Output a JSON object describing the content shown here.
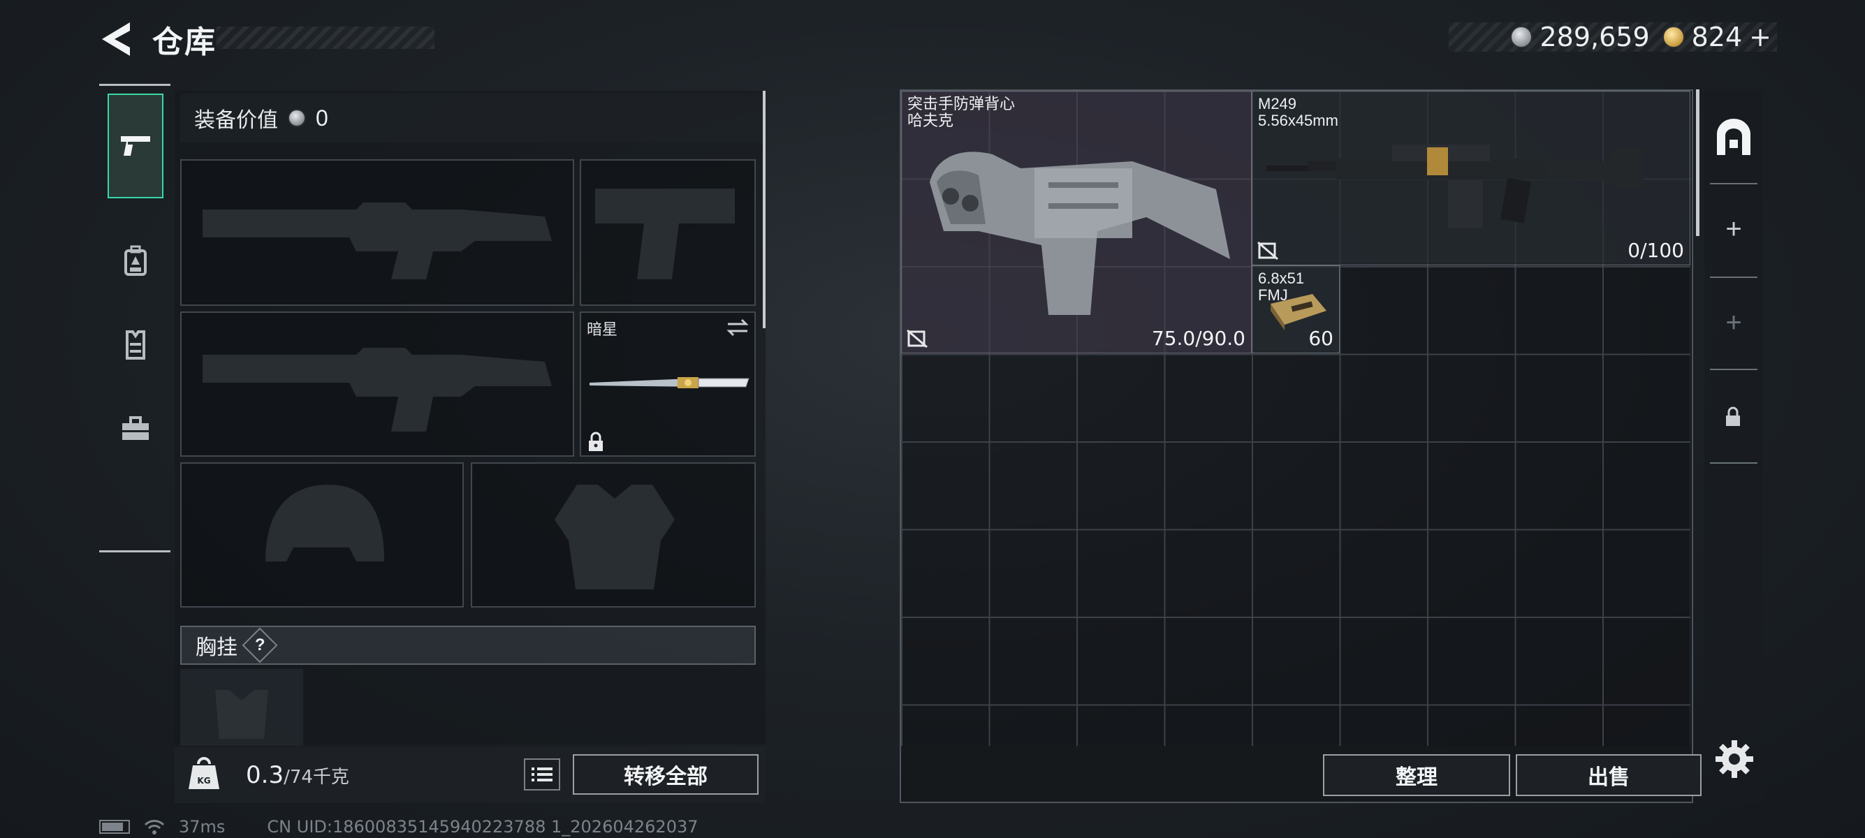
{
  "header": {
    "title": "仓库",
    "currency_silver": "289,659",
    "currency_gold": "824",
    "add_label": "+"
  },
  "sidebar": {
    "tabs": [
      {
        "icon": "pistol-icon",
        "active": true
      },
      {
        "icon": "backpack-icon",
        "active": false
      },
      {
        "icon": "vest-icon",
        "active": false
      },
      {
        "icon": "toolbox-icon",
        "active": false
      }
    ]
  },
  "equipment": {
    "value_label": "装备价值",
    "value": "0",
    "melee_slot_name": "暗星",
    "chest_rig_label": "胸挂",
    "help_label": "?"
  },
  "footer_left": {
    "weight_current": "0.3",
    "weight_max": "/74千克",
    "transfer_all_label": "转移全部"
  },
  "stash": {
    "items": [
      {
        "name_line1": "突击手防弹背心",
        "name_line2": "哈夫克",
        "value": "75.0/90.0"
      },
      {
        "name_line1": "M249",
        "name_line2": "5.56x45mm",
        "value": "0/100"
      },
      {
        "name_line1": "6.8x51",
        "name_line2": "FMJ",
        "value": "60"
      }
    ],
    "sort_label": "整理",
    "sell_label": "出售"
  },
  "right_bar": {
    "plus_1": "+",
    "plus_2": "+"
  },
  "status": {
    "ping": "37ms",
    "uid": "CN UID:18600835145940223788 1_202604262037"
  },
  "colors": {
    "accent": "#39d9a6",
    "background": "#1d2227"
  }
}
